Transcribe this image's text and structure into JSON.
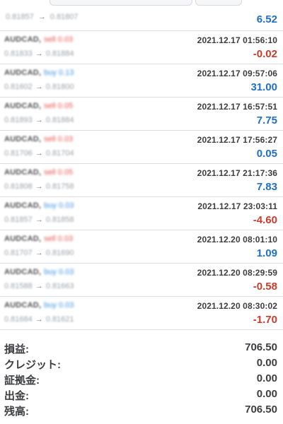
{
  "top_row": {
    "price_from": "0.81857",
    "arrow": "→",
    "price_to": "0.81807",
    "profit": "6.52"
  },
  "trades": [
    {
      "symbol": "AUDCAD,",
      "side": "sell 0.03",
      "side_type": "sell",
      "price_from": "0.81833",
      "arrow": "→",
      "price_to": "0.81884",
      "time": "2021.12.17 01:56:10",
      "profit": "-0.02",
      "sign": "neg"
    },
    {
      "symbol": "AUDCAD,",
      "side": "buy 0.13",
      "side_type": "buy",
      "price_from": "0.81602",
      "arrow": "→",
      "price_to": "0.81800",
      "time": "2021.12.17 09:57:06",
      "profit": "31.00",
      "sign": "pos"
    },
    {
      "symbol": "AUDCAD,",
      "side": "sell 0.05",
      "side_type": "sell",
      "price_from": "0.81893",
      "arrow": "→",
      "price_to": "0.81884",
      "time": "2021.12.17 16:57:51",
      "profit": "7.75",
      "sign": "pos"
    },
    {
      "symbol": "AUDCAD,",
      "side": "sell 0.03",
      "side_type": "sell",
      "price_from": "0.81706",
      "arrow": "→",
      "price_to": "0.81704",
      "time": "2021.12.17 17:56:27",
      "profit": "0.05",
      "sign": "pos"
    },
    {
      "symbol": "AUDCAD,",
      "side": "sell 0.05",
      "side_type": "sell",
      "price_from": "0.81808",
      "arrow": "→",
      "price_to": "0.81758",
      "time": "2021.12.17 21:17:36",
      "profit": "7.83",
      "sign": "pos"
    },
    {
      "symbol": "AUDCAD,",
      "side": "buy 0.03",
      "side_type": "buy",
      "price_from": "0.81857",
      "arrow": "→",
      "price_to": "0.81858",
      "time": "2021.12.17 23:03:11",
      "profit": "-4.60",
      "sign": "neg"
    },
    {
      "symbol": "AUDCAD,",
      "side": "sell 0.03",
      "side_type": "sell",
      "price_from": "0.81707",
      "arrow": "→",
      "price_to": "0.81690",
      "time": "2021.12.20 08:01:10",
      "profit": "1.09",
      "sign": "pos"
    },
    {
      "symbol": "AUDCAD,",
      "side": "buy 0.03",
      "side_type": "buy",
      "price_from": "0.81588",
      "arrow": "→",
      "price_to": "0.81663",
      "time": "2021.12.20 08:29:59",
      "profit": "-0.58",
      "sign": "neg"
    },
    {
      "symbol": "AUDCAD,",
      "side": "buy 0.03",
      "side_type": "buy",
      "price_from": "0.81684",
      "arrow": "→",
      "price_to": "0.81621",
      "time": "2021.12.20 08:30:02",
      "profit": "-1.70",
      "sign": "neg"
    }
  ],
  "summary": [
    {
      "label": "損益:",
      "value": "706.50"
    },
    {
      "label": "クレジット:",
      "value": "0.00"
    },
    {
      "label": "証拠金:",
      "value": "0.00"
    },
    {
      "label": "出金:",
      "value": "0.00"
    },
    {
      "label": "残高:",
      "value": "706.50"
    }
  ],
  "colors": {
    "profit_positive": "#1f6fc8",
    "profit_negative": "#cc3a2c",
    "sell": "#e2524a",
    "buy": "#3a8fe0"
  }
}
